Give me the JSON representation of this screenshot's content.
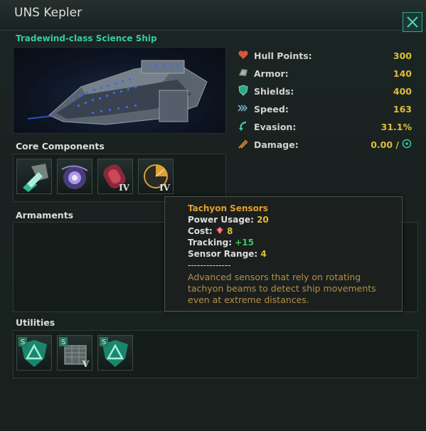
{
  "window": {
    "ship_name": "UNS Kepler",
    "ship_class": "Tradewind-class Science Ship",
    "close_label": "close"
  },
  "stats": [
    {
      "label": "Hull Points:",
      "value": "300",
      "icon": "heart-icon"
    },
    {
      "label": "Armor:",
      "value": "140",
      "icon": "armor-icon"
    },
    {
      "label": "Shields:",
      "value": "400",
      "icon": "shield-icon"
    },
    {
      "label": "Speed:",
      "value": "163",
      "icon": "speed-icon"
    },
    {
      "label": "Evasion:",
      "value": "31.1%",
      "icon": "evasion-icon"
    },
    {
      "label": "Damage:",
      "value": "0.00 /",
      "icon": "damage-icon"
    }
  ],
  "sections": {
    "core_components": "Core Components",
    "armaments": "Armaments",
    "utilities": "Utilities"
  },
  "core_components": [
    {
      "icon": "thruster-icon",
      "tier": ""
    },
    {
      "icon": "jump-drive-icon",
      "tier": ""
    },
    {
      "icon": "reactor-icon",
      "tier": "IV"
    },
    {
      "icon": "sensor-icon",
      "tier": "IV"
    }
  ],
  "utilities": [
    {
      "icon": "shield-generator-icon",
      "tier": ""
    },
    {
      "icon": "armor-plate-icon",
      "tier": "V"
    },
    {
      "icon": "shield-generator-icon",
      "tier": ""
    }
  ],
  "tooltip": {
    "title": "Tachyon Sensors",
    "power_usage_label": "Power Usage:",
    "power_usage_value": "20",
    "cost_label": "Cost:",
    "cost_value": "8",
    "tracking_label": "Tracking:",
    "tracking_value": "+15",
    "sensor_range_label": "Sensor Range:",
    "sensor_range_value": "4",
    "separator": "--------------",
    "description_1": "Advanced sensors that rely on rotating",
    "description_2": "tachyon beams to detect ship movements",
    "description_3": "even at extreme distances."
  },
  "colors": {
    "accent": "#3ad0a8",
    "value": "#e6c33c",
    "tooltip_title": "#e8a530",
    "tooltip_desc": "#b9944b",
    "positive": "#3fce5c"
  }
}
